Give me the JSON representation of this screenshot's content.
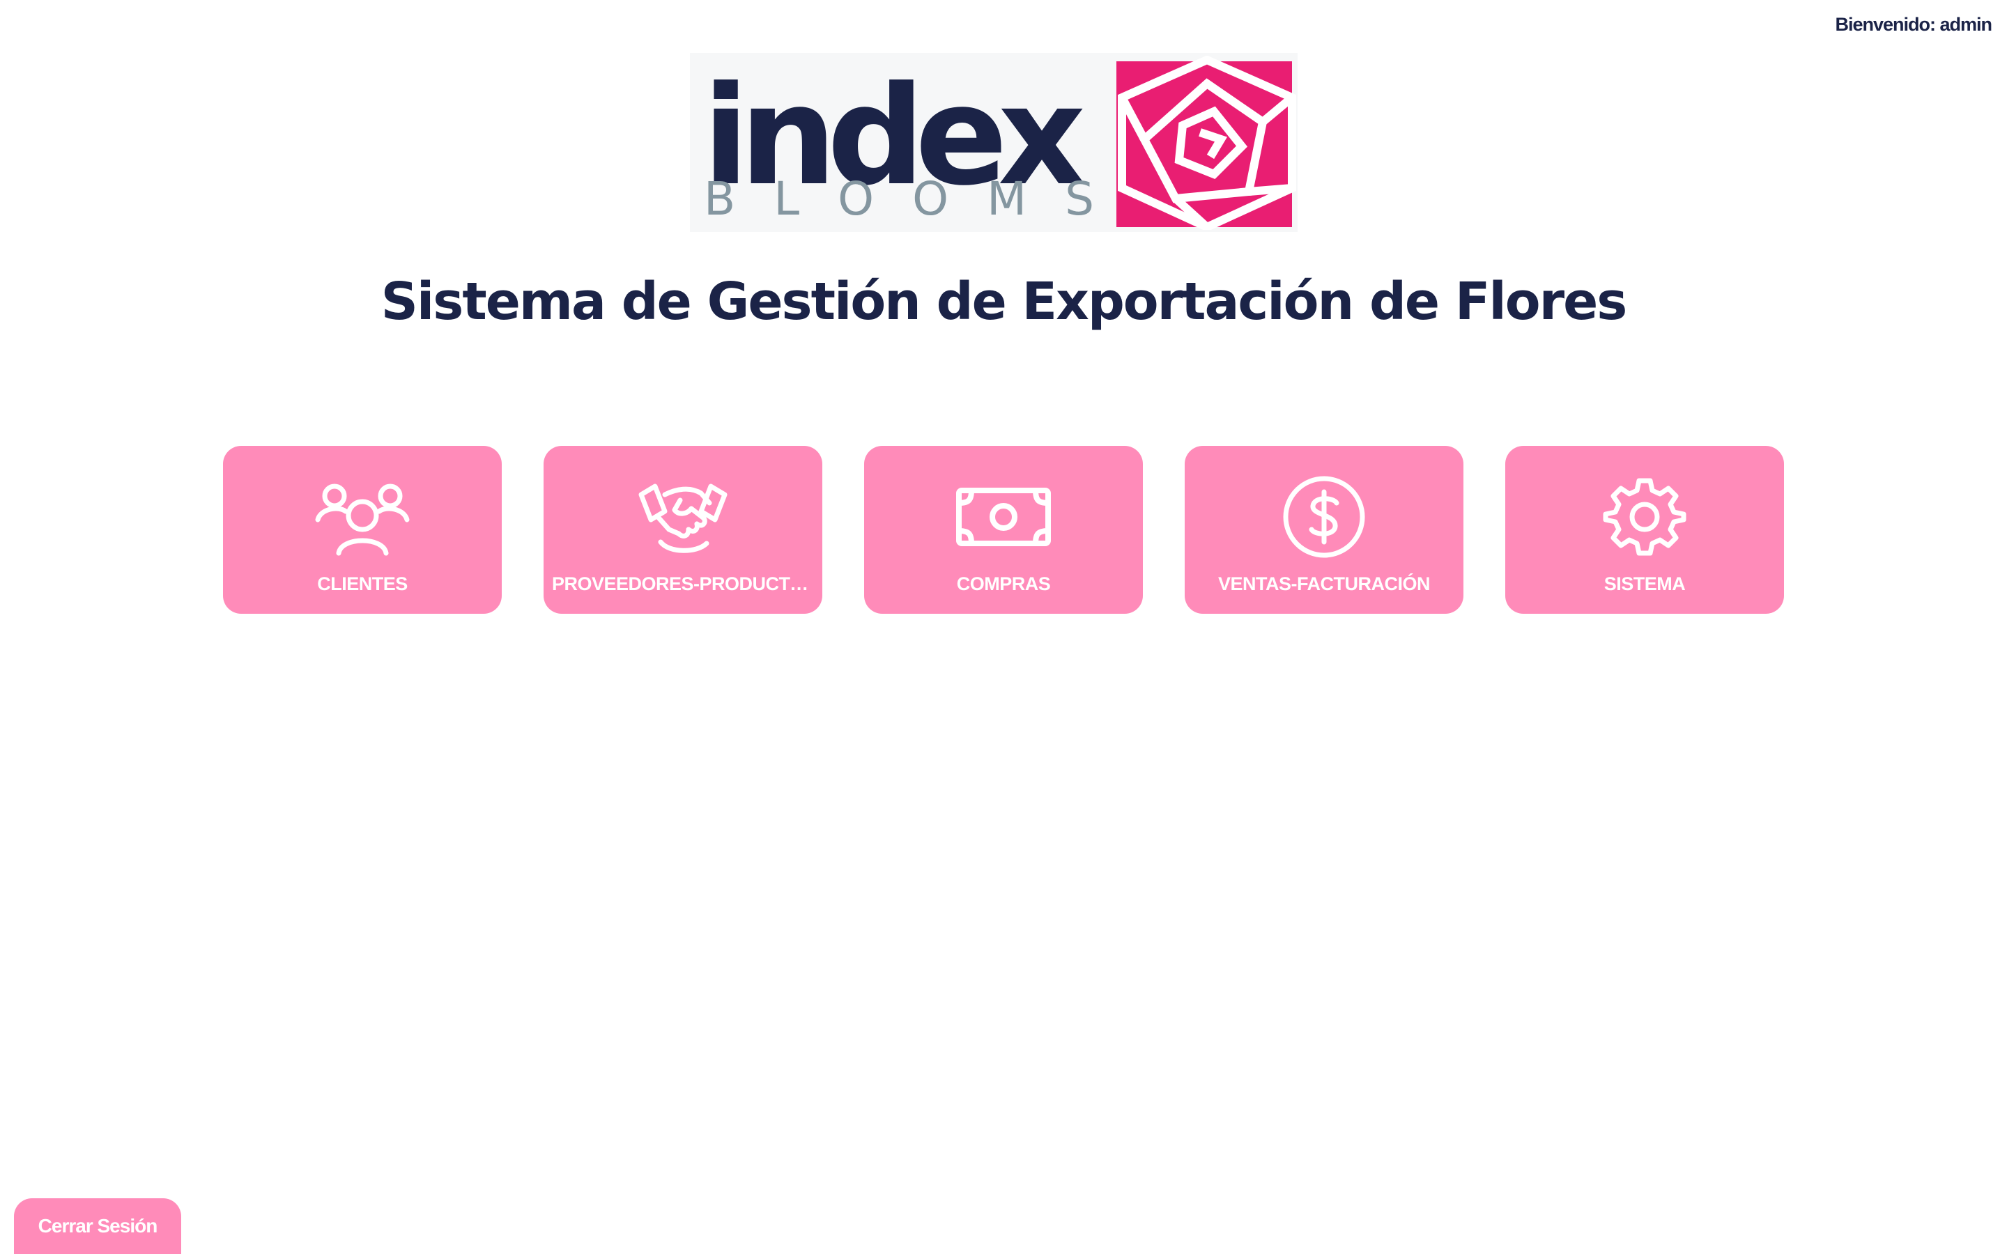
{
  "header": {
    "welcome_text": "Bienvenido: admin"
  },
  "logo": {
    "word": "index",
    "subword": [
      "B",
      "L",
      "O",
      "O",
      "M",
      "S"
    ],
    "colors": {
      "navy": "#1b2347",
      "gray": "#8496a0",
      "rose": "#e91e72"
    }
  },
  "main": {
    "title": "Sistema de Gestión de Exportación de Flores",
    "tiles": [
      {
        "label": "CLIENTES",
        "icon": "users-icon"
      },
      {
        "label": "PROVEEDORES-PRODUCTOS",
        "icon": "handshake-icon"
      },
      {
        "label": "COMPRAS",
        "icon": "cash-icon"
      },
      {
        "label": "VENTAS-FACTURACIÓN",
        "icon": "dollar-circle-icon"
      },
      {
        "label": "SISTEMA",
        "icon": "gear-icon"
      }
    ]
  },
  "footer": {
    "logout_label": "Cerrar Sesión"
  },
  "colors": {
    "accent": "#ff8bb9",
    "text_dark": "#1b2347",
    "tile_text": "#ffffff"
  }
}
